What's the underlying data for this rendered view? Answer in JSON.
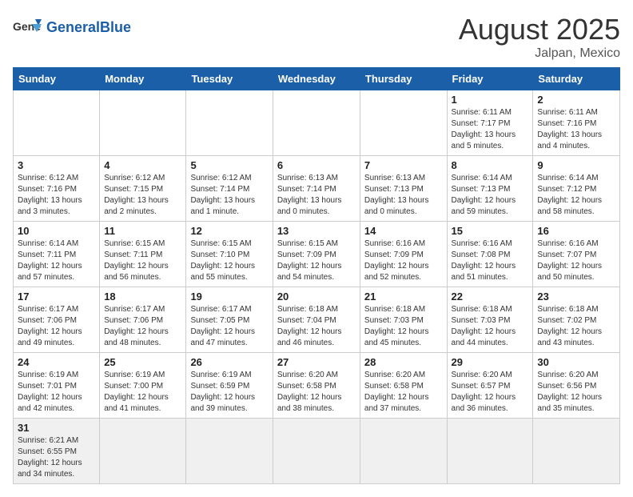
{
  "header": {
    "logo_general": "General",
    "logo_blue": "Blue",
    "month_title": "August 2025",
    "subtitle": "Jalpan, Mexico"
  },
  "weekdays": [
    "Sunday",
    "Monday",
    "Tuesday",
    "Wednesday",
    "Thursday",
    "Friday",
    "Saturday"
  ],
  "weeks": [
    [
      {
        "day": "",
        "info": ""
      },
      {
        "day": "",
        "info": ""
      },
      {
        "day": "",
        "info": ""
      },
      {
        "day": "",
        "info": ""
      },
      {
        "day": "",
        "info": ""
      },
      {
        "day": "1",
        "info": "Sunrise: 6:11 AM\nSunset: 7:17 PM\nDaylight: 13 hours\nand 5 minutes."
      },
      {
        "day": "2",
        "info": "Sunrise: 6:11 AM\nSunset: 7:16 PM\nDaylight: 13 hours\nand 4 minutes."
      }
    ],
    [
      {
        "day": "3",
        "info": "Sunrise: 6:12 AM\nSunset: 7:16 PM\nDaylight: 13 hours\nand 3 minutes."
      },
      {
        "day": "4",
        "info": "Sunrise: 6:12 AM\nSunset: 7:15 PM\nDaylight: 13 hours\nand 2 minutes."
      },
      {
        "day": "5",
        "info": "Sunrise: 6:12 AM\nSunset: 7:14 PM\nDaylight: 13 hours\nand 1 minute."
      },
      {
        "day": "6",
        "info": "Sunrise: 6:13 AM\nSunset: 7:14 PM\nDaylight: 13 hours\nand 0 minutes."
      },
      {
        "day": "7",
        "info": "Sunrise: 6:13 AM\nSunset: 7:13 PM\nDaylight: 13 hours\nand 0 minutes."
      },
      {
        "day": "8",
        "info": "Sunrise: 6:14 AM\nSunset: 7:13 PM\nDaylight: 12 hours\nand 59 minutes."
      },
      {
        "day": "9",
        "info": "Sunrise: 6:14 AM\nSunset: 7:12 PM\nDaylight: 12 hours\nand 58 minutes."
      }
    ],
    [
      {
        "day": "10",
        "info": "Sunrise: 6:14 AM\nSunset: 7:11 PM\nDaylight: 12 hours\nand 57 minutes."
      },
      {
        "day": "11",
        "info": "Sunrise: 6:15 AM\nSunset: 7:11 PM\nDaylight: 12 hours\nand 56 minutes."
      },
      {
        "day": "12",
        "info": "Sunrise: 6:15 AM\nSunset: 7:10 PM\nDaylight: 12 hours\nand 55 minutes."
      },
      {
        "day": "13",
        "info": "Sunrise: 6:15 AM\nSunset: 7:09 PM\nDaylight: 12 hours\nand 54 minutes."
      },
      {
        "day": "14",
        "info": "Sunrise: 6:16 AM\nSunset: 7:09 PM\nDaylight: 12 hours\nand 52 minutes."
      },
      {
        "day": "15",
        "info": "Sunrise: 6:16 AM\nSunset: 7:08 PM\nDaylight: 12 hours\nand 51 minutes."
      },
      {
        "day": "16",
        "info": "Sunrise: 6:16 AM\nSunset: 7:07 PM\nDaylight: 12 hours\nand 50 minutes."
      }
    ],
    [
      {
        "day": "17",
        "info": "Sunrise: 6:17 AM\nSunset: 7:06 PM\nDaylight: 12 hours\nand 49 minutes."
      },
      {
        "day": "18",
        "info": "Sunrise: 6:17 AM\nSunset: 7:06 PM\nDaylight: 12 hours\nand 48 minutes."
      },
      {
        "day": "19",
        "info": "Sunrise: 6:17 AM\nSunset: 7:05 PM\nDaylight: 12 hours\nand 47 minutes."
      },
      {
        "day": "20",
        "info": "Sunrise: 6:18 AM\nSunset: 7:04 PM\nDaylight: 12 hours\nand 46 minutes."
      },
      {
        "day": "21",
        "info": "Sunrise: 6:18 AM\nSunset: 7:03 PM\nDaylight: 12 hours\nand 45 minutes."
      },
      {
        "day": "22",
        "info": "Sunrise: 6:18 AM\nSunset: 7:03 PM\nDaylight: 12 hours\nand 44 minutes."
      },
      {
        "day": "23",
        "info": "Sunrise: 6:18 AM\nSunset: 7:02 PM\nDaylight: 12 hours\nand 43 minutes."
      }
    ],
    [
      {
        "day": "24",
        "info": "Sunrise: 6:19 AM\nSunset: 7:01 PM\nDaylight: 12 hours\nand 42 minutes."
      },
      {
        "day": "25",
        "info": "Sunrise: 6:19 AM\nSunset: 7:00 PM\nDaylight: 12 hours\nand 41 minutes."
      },
      {
        "day": "26",
        "info": "Sunrise: 6:19 AM\nSunset: 6:59 PM\nDaylight: 12 hours\nand 39 minutes."
      },
      {
        "day": "27",
        "info": "Sunrise: 6:20 AM\nSunset: 6:58 PM\nDaylight: 12 hours\nand 38 minutes."
      },
      {
        "day": "28",
        "info": "Sunrise: 6:20 AM\nSunset: 6:58 PM\nDaylight: 12 hours\nand 37 minutes."
      },
      {
        "day": "29",
        "info": "Sunrise: 6:20 AM\nSunset: 6:57 PM\nDaylight: 12 hours\nand 36 minutes."
      },
      {
        "day": "30",
        "info": "Sunrise: 6:20 AM\nSunset: 6:56 PM\nDaylight: 12 hours\nand 35 minutes."
      }
    ],
    [
      {
        "day": "31",
        "info": "Sunrise: 6:21 AM\nSunset: 6:55 PM\nDaylight: 12 hours\nand 34 minutes."
      },
      {
        "day": "",
        "info": ""
      },
      {
        "day": "",
        "info": ""
      },
      {
        "day": "",
        "info": ""
      },
      {
        "day": "",
        "info": ""
      },
      {
        "day": "",
        "info": ""
      },
      {
        "day": "",
        "info": ""
      }
    ]
  ]
}
